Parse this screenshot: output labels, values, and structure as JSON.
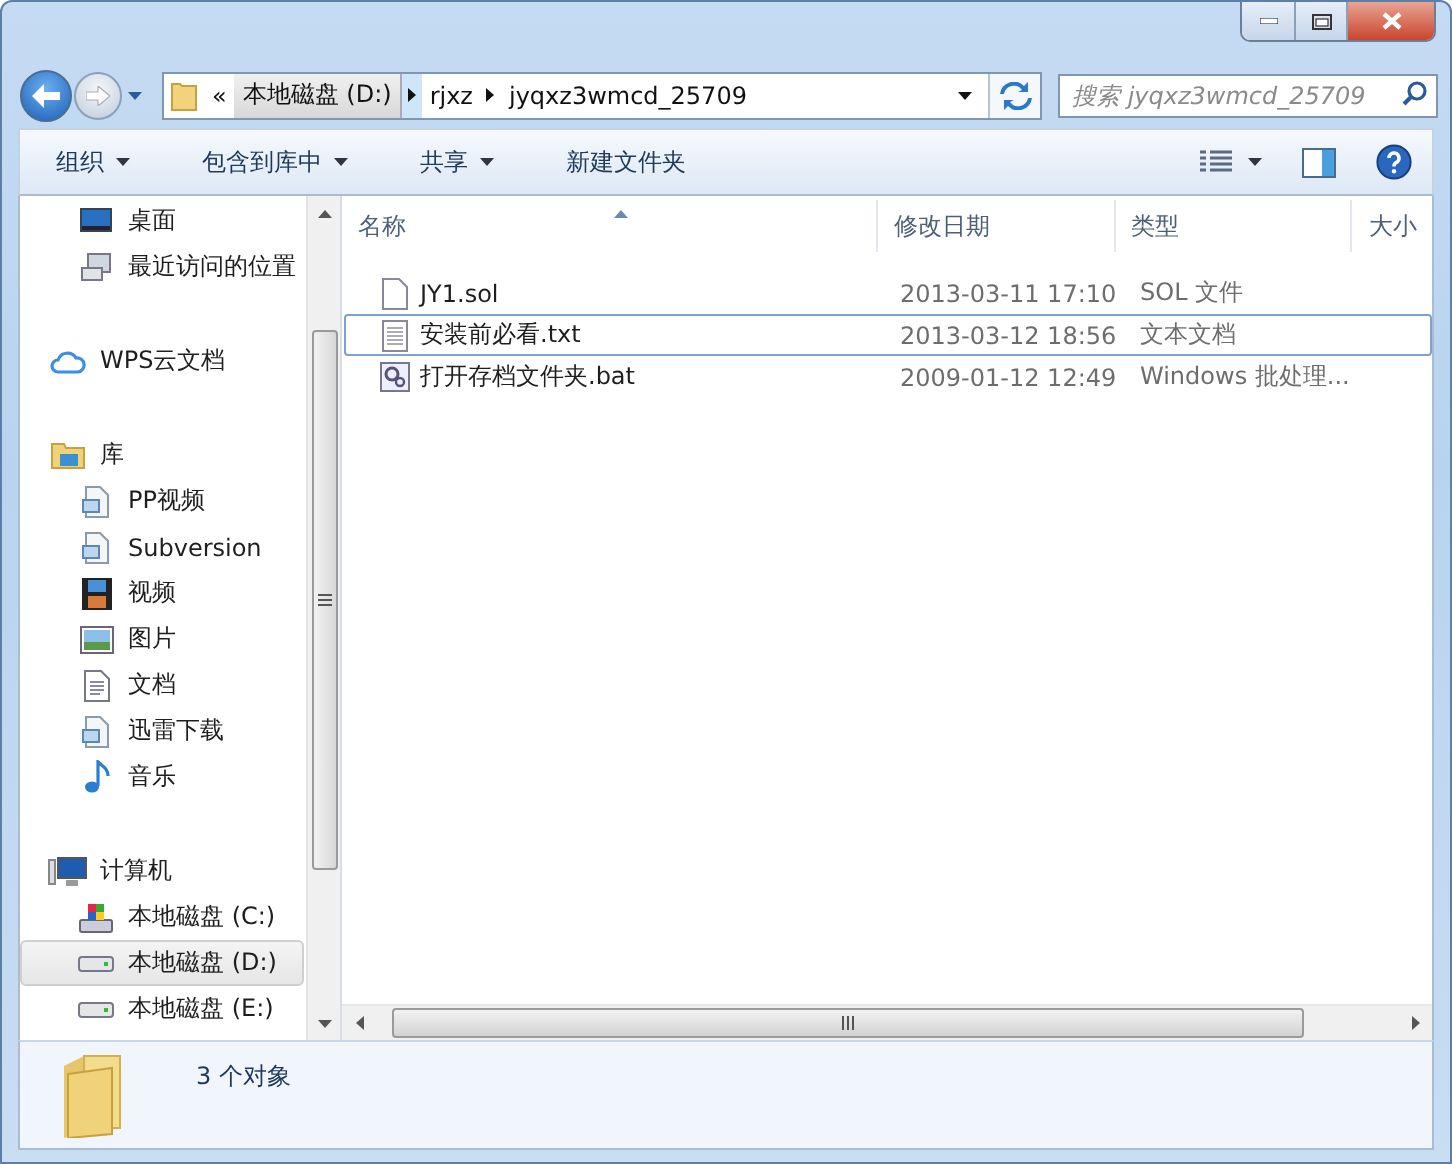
{
  "address": {
    "overflow": "«",
    "crumbs": [
      "本地磁盘 (D:)",
      "rjxz",
      "jyqxz3wmcd_25709"
    ],
    "search_placeholder": "搜索 jyqxz3wmcd_25709"
  },
  "toolbar": {
    "items": [
      {
        "label": "组织",
        "dropdown": true
      },
      {
        "label": "包含到库中",
        "dropdown": true
      },
      {
        "label": "共享",
        "dropdown": true
      },
      {
        "label": "新建文件夹",
        "dropdown": false
      }
    ]
  },
  "sidebar": {
    "sections": [
      {
        "children": [
          {
            "label": "桌面",
            "kind": "desktop",
            "selected": false
          },
          {
            "label": "最近访问的位置",
            "kind": "recent",
            "selected": false
          }
        ]
      },
      {
        "label": "WPS云文档",
        "kind": "cloud"
      },
      {
        "label": "库",
        "kind": "library",
        "children": [
          {
            "label": "PP视频",
            "kind": "doclib",
            "selected": false
          },
          {
            "label": "Subversion",
            "kind": "doclib",
            "selected": false
          },
          {
            "label": "视频",
            "kind": "film",
            "selected": false
          },
          {
            "label": "图片",
            "kind": "picture",
            "selected": false
          },
          {
            "label": "文档",
            "kind": "doc",
            "selected": false
          },
          {
            "label": "迅雷下载",
            "kind": "doclib",
            "selected": false
          },
          {
            "label": "音乐",
            "kind": "music",
            "selected": false
          }
        ]
      },
      {
        "label": "计算机",
        "kind": "computer",
        "children": [
          {
            "label": "本地磁盘 (C:)",
            "kind": "sysdrive",
            "selected": false
          },
          {
            "label": "本地磁盘 (D:)",
            "kind": "drive",
            "selected": true
          },
          {
            "label": "本地磁盘 (E:)",
            "kind": "drive",
            "selected": false
          }
        ]
      }
    ]
  },
  "table": {
    "columns": [
      "名称",
      "修改日期",
      "类型",
      "大小"
    ],
    "rows": [
      {
        "name": "JY1.sol",
        "date": "2013-03-11 17:10",
        "type": "SOL 文件",
        "kind": "file",
        "selected": false
      },
      {
        "name": "安装前必看.txt",
        "date": "2013-03-12 18:56",
        "type": "文本文档",
        "kind": "text",
        "selected": true
      },
      {
        "name": "打开存档文件夹.bat",
        "date": "2009-01-12 12:49",
        "type": "Windows 批处理...",
        "kind": "batch",
        "selected": false
      }
    ]
  },
  "status_bar": {
    "count": "3 个对象"
  }
}
